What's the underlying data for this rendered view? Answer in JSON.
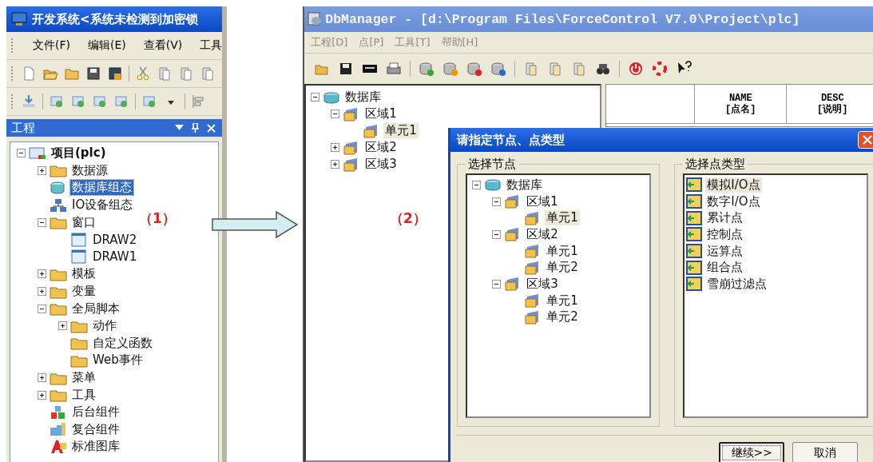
{
  "dev_window": {
    "title": "开发系统<系统未检测到加密锁",
    "menu": [
      "文件(F)",
      "编辑(E)",
      "查看(V)",
      "工具"
    ],
    "panel": {
      "title": "工程"
    },
    "tree": [
      {
        "label": "项目(plc)",
        "kind": "project",
        "expanded": true,
        "selected": false,
        "children": [
          {
            "label": "数据源",
            "kind": "folder",
            "expanded": false,
            "selected": false
          },
          {
            "label": "数据库组态",
            "kind": "database",
            "selected": true
          },
          {
            "label": "IO设备组态",
            "kind": "network",
            "selected": false
          },
          {
            "label": "窗口",
            "kind": "folder",
            "expanded": true,
            "selected": false,
            "children": [
              {
                "label": "DRAW2",
                "kind": "window",
                "selected": false
              },
              {
                "label": "DRAW1",
                "kind": "window",
                "selected": false
              }
            ]
          },
          {
            "label": "模板",
            "kind": "folder",
            "expanded": false,
            "selected": false
          },
          {
            "label": "变量",
            "kind": "folder",
            "expanded": false,
            "selected": false
          },
          {
            "label": "全局脚本",
            "kind": "folder",
            "expanded": true,
            "selected": false,
            "children": [
              {
                "label": "动作",
                "kind": "folder",
                "expanded": false,
                "selected": false
              },
              {
                "label": "自定义函数",
                "kind": "folder",
                "selected": false
              },
              {
                "label": "Web事件",
                "kind": "folder",
                "selected": false
              }
            ]
          },
          {
            "label": "菜单",
            "kind": "folder",
            "expanded": false,
            "selected": false
          },
          {
            "label": "工具",
            "kind": "folder",
            "expanded": false,
            "selected": false
          },
          {
            "label": "后台组件",
            "kind": "component",
            "selected": false
          },
          {
            "label": "复合组件",
            "kind": "composite",
            "selected": false
          },
          {
            "label": "标准图库",
            "kind": "library",
            "selected": false
          }
        ]
      }
    ]
  },
  "annotations": [
    "（1）",
    "（2）"
  ],
  "db_window": {
    "title": "DbManager - [d:\\Program Files\\ForceControl V7.0\\Project\\plc]",
    "menu": [
      "工程[D]",
      "点[P]",
      "工具[T]",
      "帮助[H]"
    ],
    "tree": [
      {
        "label": "数据库",
        "kind": "database",
        "expanded": true,
        "selected": false,
        "children": [
          {
            "label": "区域1",
            "kind": "area",
            "expanded": true,
            "selected": false,
            "children": [
              {
                "label": "单元1",
                "kind": "area",
                "selected": true
              }
            ]
          },
          {
            "label": "区域2",
            "kind": "area",
            "expanded": false,
            "selected": false
          },
          {
            "label": "区域3",
            "kind": "area",
            "expanded": false,
            "selected": false
          }
        ]
      }
    ],
    "grid_columns": [
      {
        "label": "NAME",
        "sublabel": "[点名]"
      },
      {
        "label": "DESC",
        "sublabel": "[说明]"
      }
    ]
  },
  "dialog": {
    "title": "请指定节点、点类型",
    "node_group": {
      "label": "选择节点",
      "tree": [
        {
          "label": "数据库",
          "kind": "database",
          "expanded": true,
          "selected": false,
          "children": [
            {
              "label": "区域1",
              "kind": "area",
              "expanded": true,
              "selected": false,
              "children": [
                {
                  "label": "单元1",
                  "kind": "area",
                  "selected": true
                }
              ]
            },
            {
              "label": "区域2",
              "kind": "area",
              "expanded": true,
              "selected": false,
              "children": [
                {
                  "label": "单元1",
                  "kind": "area",
                  "selected": false
                },
                {
                  "label": "单元2",
                  "kind": "area",
                  "selected": false
                }
              ]
            },
            {
              "label": "区域3",
              "kind": "area",
              "expanded": true,
              "selected": false,
              "children": [
                {
                  "label": "单元1",
                  "kind": "area",
                  "selected": false
                },
                {
                  "label": "单元2",
                  "kind": "area",
                  "selected": false
                }
              ]
            }
          ]
        }
      ]
    },
    "type_group": {
      "label": "选择点类型",
      "items": [
        {
          "label": "模拟I/O点",
          "selected": true
        },
        {
          "label": "数字I/O点",
          "selected": false
        },
        {
          "label": "累计点",
          "selected": false
        },
        {
          "label": "控制点",
          "selected": false
        },
        {
          "label": "运算点",
          "selected": false
        },
        {
          "label": "组合点",
          "selected": false
        },
        {
          "label": "雪崩过滤点",
          "selected": false
        }
      ]
    },
    "buttons": [
      {
        "label": "继续>>",
        "default": true
      },
      {
        "label": "取消",
        "default": false
      }
    ]
  }
}
